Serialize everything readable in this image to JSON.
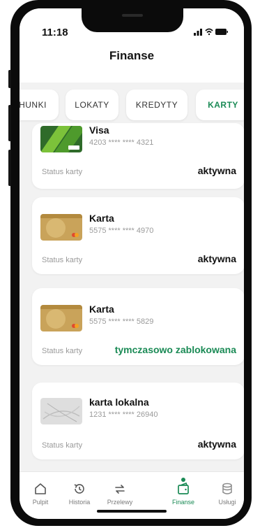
{
  "status_bar": {
    "time": "11:18"
  },
  "header": {
    "title": "Finanse"
  },
  "tabs": [
    {
      "label": "HUNKI",
      "active": false
    },
    {
      "label": "LOKATY",
      "active": false
    },
    {
      "label": "KREDYTY",
      "active": false
    },
    {
      "label": "KARTY",
      "active": true
    }
  ],
  "cards": [
    {
      "name": "Visa",
      "number": "4203 **** **** 4321",
      "status_label": "Status karty",
      "status": "aktywna",
      "image": "visa-card-green"
    },
    {
      "name": "Karta",
      "number": "5575 **** **** 4970",
      "status_label": "Status karty",
      "status": "aktywna",
      "image": "mastercard-gold"
    },
    {
      "name": "Karta",
      "number": "5575 **** **** 5829",
      "status_label": "Status karty",
      "status": "tymczasowo zablokowana",
      "image": "mastercard-gold"
    },
    {
      "name": "karta lokalna",
      "number": "1231 **** **** 26940",
      "status_label": "Status karty",
      "status": "aktywna",
      "image": "local-card-grey"
    }
  ],
  "bottom_nav": [
    {
      "label": "Pulpit",
      "icon": "home-icon",
      "active": false
    },
    {
      "label": "Historia",
      "icon": "history-icon",
      "active": false
    },
    {
      "label": "Przelewy",
      "icon": "transfer-icon",
      "active": false
    },
    {
      "label": "Finanse",
      "icon": "wallet-icon",
      "active": true
    },
    {
      "label": "Usługi",
      "icon": "services-icon",
      "active": false
    }
  ],
  "colors": {
    "accent": "#1a8a55",
    "background": "#f2f2f2",
    "card": "#ffffff"
  }
}
